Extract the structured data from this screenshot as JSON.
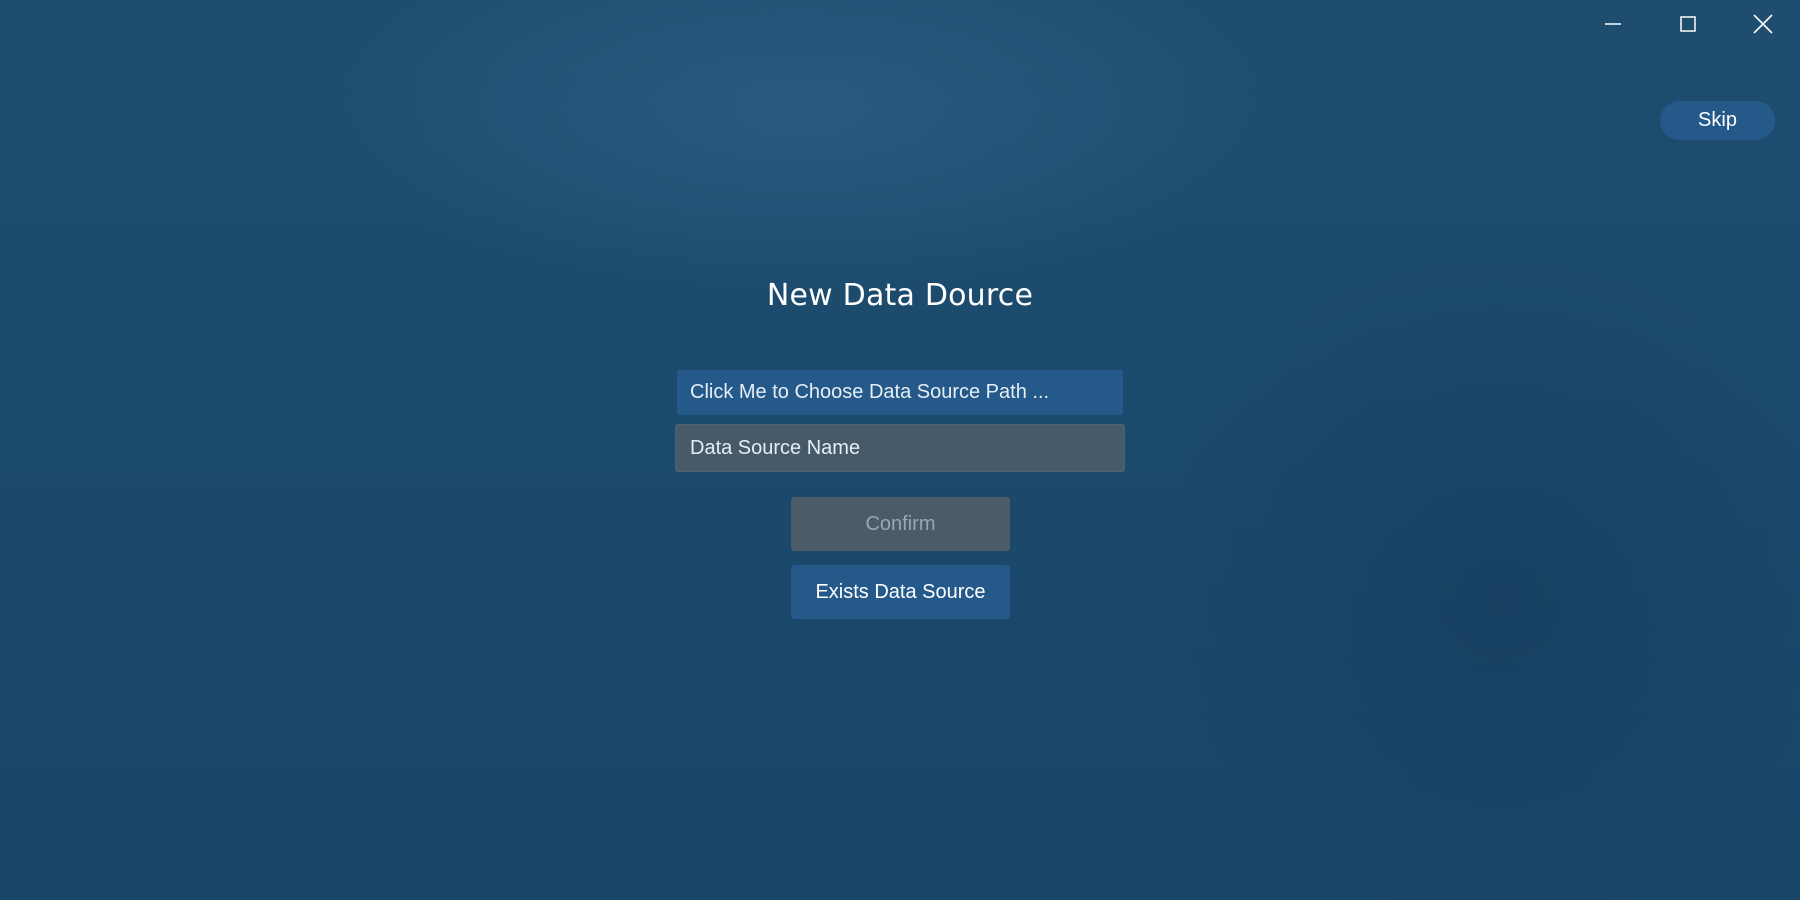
{
  "window": {
    "controls": [
      {
        "icon": "minimize-icon"
      },
      {
        "icon": "maximize-icon"
      },
      {
        "icon": "close-icon"
      }
    ]
  },
  "header": {
    "skip_label": "Skip"
  },
  "main": {
    "title": "New Data Dource",
    "path_chooser_label": "Click Me to Choose Data Source Path ...",
    "name_input": {
      "value": "",
      "placeholder": "Data Source Name"
    },
    "confirm_label": "Confirm",
    "exists_label": "Exists Data Source"
  },
  "colors": {
    "background": "#1e4b6d",
    "accent": "#24598a",
    "input_background": "#465a69",
    "disabled_button": "#4b5b67",
    "disabled_text": "#9aa8b3",
    "text": "#ffffff"
  }
}
